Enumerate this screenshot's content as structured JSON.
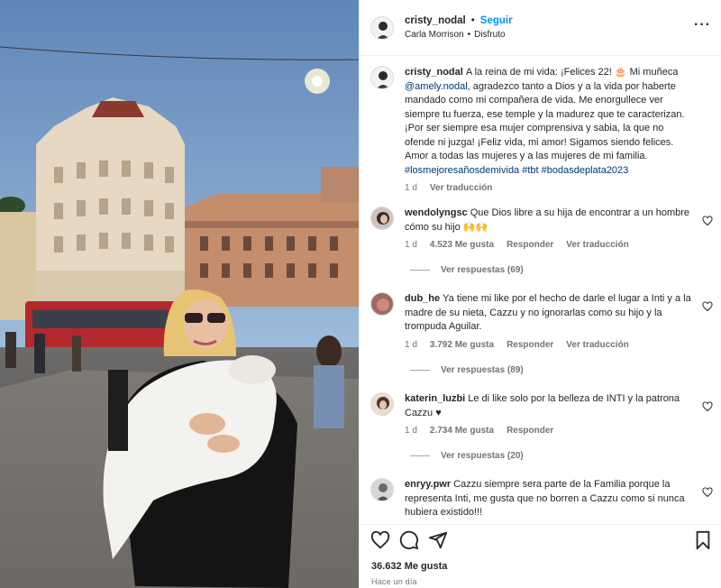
{
  "header": {
    "username": "cristy_nodal",
    "separator": "•",
    "follow_label": "Seguir",
    "audio_artist": "Carla Morrison",
    "audio_separator": "•",
    "audio_title": "Disfruto",
    "more_label": "···",
    "more_icon": "more-options-icon"
  },
  "caption": {
    "username": "cristy_nodal",
    "text_1": "A la reina de mi vida: ¡Felices 22! 🎂 Mi muñeca",
    "mention": "@amely.nodal",
    "text_2": ", agradezco tanto a Dios y a la vida por haberte mandado como mi compañera de vida. Me enorgullece ver siempre tu fuerza, ese temple y la madurez que te caracterizan. ¡Por ser siempre esa mujer comprensiva y sabia, la que no ofende ni juzga! ¡Feliz vida, mi amor! Sigamos siendo felices. Amor a todas las mujeres y a las mujeres de mi familia.",
    "hashtags": "#losmejoresañosdemivida #tbt #bodasdeplata2023",
    "age": "1 d",
    "translate_label": "Ver traducción"
  },
  "comments": [
    {
      "username": "wendolyngsc",
      "text": "Que Dios libre a su hija de encontrar a un hombre cómo su hijo 🙌🙌",
      "age": "1 d",
      "likes": "4.523 Me gusta",
      "reply_label": "Responder",
      "translate_label": "Ver traducción",
      "replies_label": "Ver respuestas (69)"
    },
    {
      "username": "dub_he",
      "text": "Ya tiene mi like por el hecho de darle el lugar a Inti y a la madre de su nieta, Cazzu y no ignorarlas como su hijo y la trompuda Aguilar.",
      "age": "1 d",
      "likes": "3.792 Me gusta",
      "reply_label": "Responder",
      "translate_label": "Ver traducción",
      "replies_label": "Ver respuestas (89)"
    },
    {
      "username": "katerin_luzbi",
      "text": "Le di like solo por la belleza de INTI y la patrona Cazzu ♥",
      "age": "1 d",
      "likes": "2.734 Me gusta",
      "reply_label": "Responder",
      "replies_label": "Ver respuestas (20)"
    },
    {
      "username": "enryy.pwr",
      "text": "Cazzu siempre sera parte de la Familia porque la representa Inti, me gusta que no borren a Cazzu como si nunca hubiera existido!!!"
    }
  ],
  "footer": {
    "likes_count": "36.632 Me gusta",
    "time": "Hace un día",
    "icons": [
      "heart-icon",
      "comment-icon",
      "share-icon",
      "bookmark-icon"
    ]
  },
  "colors": {
    "follow": "#0095f6",
    "link": "#00376b",
    "secondary_text": "#737373"
  }
}
